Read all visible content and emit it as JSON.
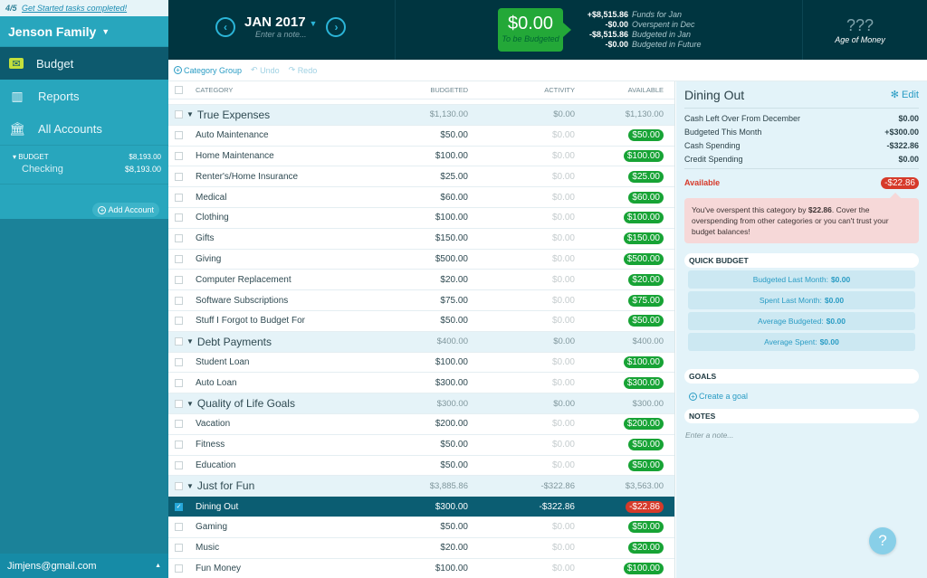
{
  "sidebar": {
    "banner_count": "4/5",
    "banner_link": "Get Started tasks completed!",
    "budget_name": "Jenson Family",
    "nav": [
      {
        "label": "Budget",
        "icon": "envelope-icon",
        "active": true
      },
      {
        "label": "Reports",
        "icon": "bar-chart-icon",
        "active": false
      },
      {
        "label": "All Accounts",
        "icon": "bank-icon",
        "active": false
      }
    ],
    "account_group": {
      "label": "BUDGET",
      "balance": "$8,193.00"
    },
    "accounts": [
      {
        "label": "Checking",
        "balance": "$8,193.00"
      }
    ],
    "add_account": "Add Account",
    "user_email": "Jimjens@gmail.com"
  },
  "header": {
    "month": "JAN 2017",
    "month_note_placeholder": "Enter a note...",
    "to_be_budgeted": {
      "amount": "$0.00",
      "label": "To be Budgeted"
    },
    "summary": [
      {
        "value": "+$8,515.86",
        "label": "Funds for Jan"
      },
      {
        "value": "-$0.00",
        "label": "Overspent in Dec"
      },
      {
        "value": "-$8,515.86",
        "label": "Budgeted in Jan"
      },
      {
        "value": "-$0.00",
        "label": "Budgeted in Future"
      }
    ],
    "age_of_money": {
      "value": "???",
      "label": "Age of Money"
    }
  },
  "toolbar": {
    "category_group": "Category Group",
    "undo": "Undo",
    "redo": "Redo"
  },
  "table": {
    "columns": {
      "category": "CATEGORY",
      "budgeted": "BUDGETED",
      "activity": "ACTIVITY",
      "available": "AVAILABLE"
    },
    "groups": [
      {
        "name": "True Expenses",
        "budgeted": "$1,130.00",
        "activity": "$0.00",
        "available": "$1,130.00",
        "items": [
          {
            "name": "Auto Maintenance",
            "budgeted": "$50.00",
            "activity": "$0.00",
            "available": "$50.00"
          },
          {
            "name": "Home Maintenance",
            "budgeted": "$100.00",
            "activity": "$0.00",
            "available": "$100.00"
          },
          {
            "name": "Renter's/Home Insurance",
            "budgeted": "$25.00",
            "activity": "$0.00",
            "available": "$25.00"
          },
          {
            "name": "Medical",
            "budgeted": "$60.00",
            "activity": "$0.00",
            "available": "$60.00"
          },
          {
            "name": "Clothing",
            "budgeted": "$100.00",
            "activity": "$0.00",
            "available": "$100.00"
          },
          {
            "name": "Gifts",
            "budgeted": "$150.00",
            "activity": "$0.00",
            "available": "$150.00"
          },
          {
            "name": "Giving",
            "budgeted": "$500.00",
            "activity": "$0.00",
            "available": "$500.00"
          },
          {
            "name": "Computer Replacement",
            "budgeted": "$20.00",
            "activity": "$0.00",
            "available": "$20.00"
          },
          {
            "name": "Software Subscriptions",
            "budgeted": "$75.00",
            "activity": "$0.00",
            "available": "$75.00"
          },
          {
            "name": "Stuff I Forgot to Budget For",
            "budgeted": "$50.00",
            "activity": "$0.00",
            "available": "$50.00"
          }
        ]
      },
      {
        "name": "Debt Payments",
        "budgeted": "$400.00",
        "activity": "$0.00",
        "available": "$400.00",
        "items": [
          {
            "name": "Student Loan",
            "budgeted": "$100.00",
            "activity": "$0.00",
            "available": "$100.00"
          },
          {
            "name": "Auto Loan",
            "budgeted": "$300.00",
            "activity": "$0.00",
            "available": "$300.00"
          }
        ]
      },
      {
        "name": "Quality of Life Goals",
        "budgeted": "$300.00",
        "activity": "$0.00",
        "available": "$300.00",
        "items": [
          {
            "name": "Vacation",
            "budgeted": "$200.00",
            "activity": "$0.00",
            "available": "$200.00"
          },
          {
            "name": "Fitness",
            "budgeted": "$50.00",
            "activity": "$0.00",
            "available": "$50.00"
          },
          {
            "name": "Education",
            "budgeted": "$50.00",
            "activity": "$0.00",
            "available": "$50.00"
          }
        ]
      },
      {
        "name": "Just for Fun",
        "budgeted": "$3,885.86",
        "activity": "-$322.86",
        "available": "$3,563.00",
        "items": [
          {
            "name": "Dining Out",
            "budgeted": "$300.00",
            "activity": "-$322.86",
            "available": "-$22.86",
            "selected": true,
            "negative": true
          },
          {
            "name": "Gaming",
            "budgeted": "$50.00",
            "activity": "$0.00",
            "available": "$50.00"
          },
          {
            "name": "Music",
            "budgeted": "$20.00",
            "activity": "$0.00",
            "available": "$20.00"
          },
          {
            "name": "Fun Money",
            "budgeted": "$100.00",
            "activity": "$0.00",
            "available": "$100.00"
          }
        ]
      }
    ]
  },
  "inspector": {
    "title": "Dining Out",
    "edit": "Edit",
    "lines": [
      {
        "label": "Cash Left Over From December",
        "value": "$0.00"
      },
      {
        "label": "Budgeted This Month",
        "value": "+$300.00"
      },
      {
        "label": "Cash Spending",
        "value": "-$322.86"
      },
      {
        "label": "Credit Spending",
        "value": "$0.00"
      }
    ],
    "available_label": "Available",
    "available_value": "-$22.86",
    "warning_pre": "You've overspent this category by ",
    "warning_amount": "$22.86",
    "warning_post": ". Cover the overspending from other categories or you can't trust your budget balances!",
    "quick_budget_title": "QUICK BUDGET",
    "quick_budget": [
      {
        "label": "Budgeted Last Month:",
        "value": "$0.00"
      },
      {
        "label": "Spent Last Month:",
        "value": "$0.00"
      },
      {
        "label": "Average Budgeted:",
        "value": "$0.00"
      },
      {
        "label": "Average Spent:",
        "value": "$0.00"
      }
    ],
    "goals_title": "GOALS",
    "create_goal": "Create a goal",
    "notes_title": "NOTES",
    "notes_placeholder": "Enter a note..."
  },
  "help": "?"
}
